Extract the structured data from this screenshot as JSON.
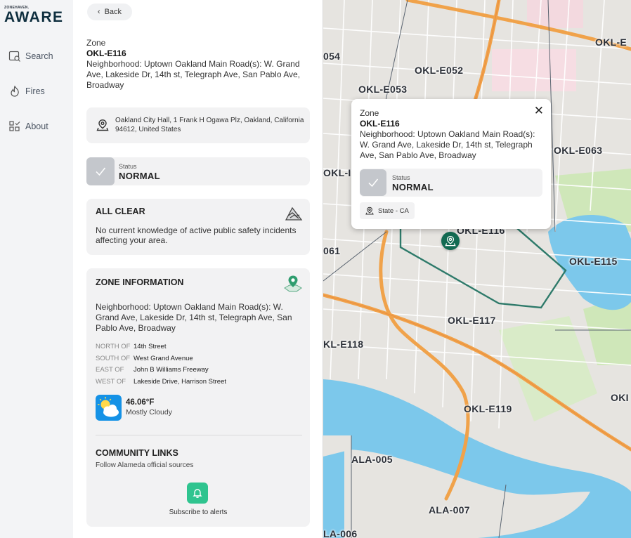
{
  "brand": {
    "small_text": "ZONEHAVEN.",
    "name": "AWARE"
  },
  "nav": [
    {
      "label": "Search",
      "icon": "search-icon"
    },
    {
      "label": "Fires",
      "icon": "fire-icon"
    },
    {
      "label": "About",
      "icon": "about-grid-icon"
    }
  ],
  "panel": {
    "back_label": "Back",
    "zone_label": "Zone",
    "zone_id": "OKL-E116",
    "zone_description": "Neighborhood: Uptown Oakland Main Road(s): W. Grand Ave, Lakeside Dr, 14th st, Telegraph Ave, San Pablo Ave, Broadway",
    "address": "Oakland City Hall, 1 Frank H Ogawa Plz, Oakland, California 94612, United States",
    "status": {
      "label": "Status",
      "value": "NORMAL"
    },
    "all_clear": {
      "title": "ALL CLEAR",
      "text": "No current knowledge of active public safety incidents affecting your area."
    },
    "zone_info": {
      "title": "ZONE INFORMATION",
      "description": "Neighborhood: Uptown Oakland Main Road(s): W. Grand Ave, Lakeside Dr, 14th st, Telegraph Ave, San Pablo Ave, Broadway",
      "bounds": [
        {
          "key": "NORTH OF",
          "value": "14th Street"
        },
        {
          "key": "SOUTH OF",
          "value": "West Grand Avenue"
        },
        {
          "key": "EAST OF",
          "value": "John B Williams Freeway"
        },
        {
          "key": "WEST OF",
          "value": "Lakeside Drive, Harrison Street"
        }
      ],
      "weather": {
        "temperature": "46.06°F",
        "condition": "Mostly Cloudy",
        "icon": "partly-cloudy-icon"
      }
    },
    "community": {
      "title": "COMMUNITY LINKS",
      "subtitle": "Follow Alameda official sources",
      "subscribe_label": "Subscribe to alerts"
    }
  },
  "map": {
    "popup": {
      "zone_label": "Zone",
      "zone_id": "OKL-E116",
      "description": "Neighborhood: Uptown Oakland Main Road(s): W. Grand Ave, Lakeside Dr, 14th st, Telegraph Ave, San Pablo Ave, Broadway",
      "status_label": "Status",
      "status_value": "NORMAL",
      "state": "State - CA",
      "close_glyph": "✕"
    },
    "zone_labels": [
      "OKL-E",
      "054",
      "OKL-E052",
      "OKL-E053",
      "OKL-E063",
      "OKL-I",
      "OKL-E116",
      "061",
      "OKL-E115",
      "OKL-E117",
      "KL-E118",
      "OKL-E119",
      "OKI",
      "ALA-005",
      "ALA-007",
      "LA-006"
    ],
    "colors": {
      "highway": "#f0a24a",
      "water": "#7cc8eb",
      "park": "#cfe7b9",
      "zone_border": "#2e7a6a",
      "land": "#e6e4e0"
    }
  },
  "colors": {
    "accent_green": "#2fc48f",
    "marker_green": "#136b52",
    "logo_dark": "#0f2f3f"
  }
}
